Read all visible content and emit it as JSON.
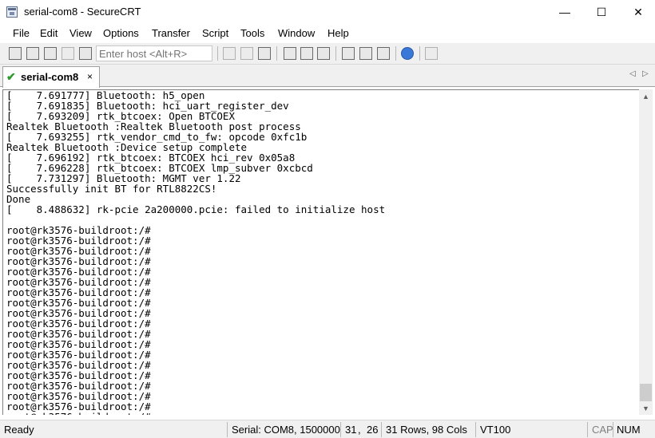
{
  "window": {
    "title": "serial-com8 - SecureCRT",
    "icon": "securecrt-app-icon",
    "controls": {
      "minimize": "—",
      "maximize": "☐",
      "close": "✕"
    }
  },
  "menu": [
    "File",
    "Edit",
    "View",
    "Options",
    "Transfer",
    "Script",
    "Tools",
    "Window",
    "Help"
  ],
  "toolbar": {
    "host_placeholder": "Enter host <Alt+R>",
    "icons": [
      "quick-connect-icon",
      "connect-icon",
      "connect-tab-icon",
      "reconnect-icon",
      "disconnect-icon",
      "copy-icon",
      "paste-icon",
      "find-icon",
      "print-icon",
      "print-screen-icon",
      "print-setup-icon",
      "session-options-icon",
      "global-options-icon",
      "keymap-icon",
      "help-icon",
      "sftp-icon"
    ]
  },
  "tab": {
    "status_icon": "connected-check-icon",
    "label": "serial-com8",
    "close": "×",
    "nav_left": "◁",
    "nav_right": "▷"
  },
  "terminal": {
    "lines": [
      "[    7.691777] Bluetooth: h5_open",
      "[    7.691835] Bluetooth: hci_uart_register_dev",
      "[    7.693209] rtk_btcoex: Open BTCOEX",
      "Realtek Bluetooth :Realtek Bluetooth post process",
      "[    7.693255] rtk_vendor_cmd_to_fw: opcode 0xfc1b",
      "Realtek Bluetooth :Device setup complete",
      "[    7.696192] rtk_btcoex: BTCOEX hci_rev 0x05a8",
      "[    7.696228] rtk_btcoex: BTCOEX lmp_subver 0xcbcd",
      "[    7.731297] Bluetooth: MGMT ver 1.22",
      "Successfully init BT for RTL8822CS!",
      "Done",
      "[    8.488632] rk-pcie 2a200000.pcie: failed to initialize host",
      "",
      "root@rk3576-buildroot:/#",
      "root@rk3576-buildroot:/#",
      "root@rk3576-buildroot:/#",
      "root@rk3576-buildroot:/#",
      "root@rk3576-buildroot:/#",
      "root@rk3576-buildroot:/#",
      "root@rk3576-buildroot:/#",
      "root@rk3576-buildroot:/#",
      "root@rk3576-buildroot:/#",
      "root@rk3576-buildroot:/#",
      "root@rk3576-buildroot:/#",
      "root@rk3576-buildroot:/#",
      "root@rk3576-buildroot:/#",
      "root@rk3576-buildroot:/#",
      "root@rk3576-buildroot:/#",
      "root@rk3576-buildroot:/#",
      "root@rk3576-buildroot:/#",
      "root@rk3576-buildroot:/#",
      "root@rk3576-buildroot:/#",
      "root@rk3576-buildroot:/#"
    ]
  },
  "status": {
    "ready": "Ready",
    "connection": "Serial: COM8, 1500000",
    "row": "31",
    "col": "26",
    "size": "31 Rows, 98 Cols",
    "terminal_type": "VT100",
    "cap": "CAP",
    "num": "NUM"
  }
}
